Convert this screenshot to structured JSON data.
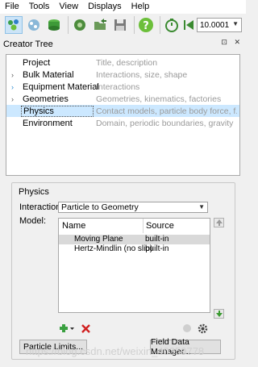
{
  "menubar": {
    "items": [
      "File",
      "Tools",
      "View",
      "Displays",
      "Help"
    ]
  },
  "toolbar": {
    "icons": [
      "particle-creator-icon",
      "bulk-material-icon",
      "geometry-icon",
      "simulator-icon",
      "open-icon",
      "save-icon",
      "help-icon",
      "timer-icon",
      "rewind-icon"
    ],
    "combo_value": "10.0001"
  },
  "panel": {
    "title": "Creator Tree",
    "controls": "⊡ ✕"
  },
  "tree": {
    "items": [
      {
        "name": "Project",
        "desc": "Title, description",
        "expander": ""
      },
      {
        "name": "Bulk Material",
        "desc": "Interactions, size, shape",
        "expander": "›"
      },
      {
        "name": "Equipment Material",
        "desc": "Interactions",
        "expander": "›"
      },
      {
        "name": "Geometries",
        "desc": "Geometries, kinematics, factories",
        "expander": "›"
      },
      {
        "name": "Physics",
        "desc": "Contact models, particle body force, f...",
        "expander": ""
      },
      {
        "name": "Environment",
        "desc": "Domain, periodic boundaries, gravity",
        "expander": ""
      }
    ]
  },
  "physics": {
    "group_title": "Physics",
    "interaction_label": "Interaction:",
    "interaction_value": "Particle to Geometry",
    "model_label": "Model:",
    "columns": [
      "Name",
      "Source"
    ],
    "rows": [
      {
        "name": "Moving Plane",
        "source": "built-in"
      },
      {
        "name": "Hertz-Mindlin (no slip)",
        "source": "built-in"
      }
    ],
    "particle_limits_label": "Particle Limits...",
    "field_data_label": "Field Data Manager..."
  },
  "watermark": "https://blog.csdn.net/weixin_40359778"
}
